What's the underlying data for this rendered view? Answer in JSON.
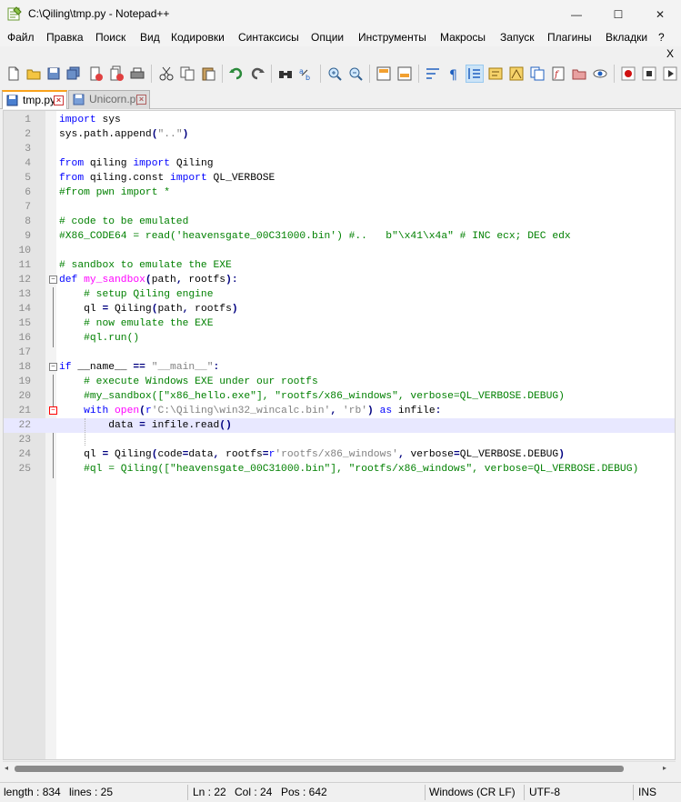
{
  "window": {
    "title": "C:\\Qiling\\tmp.py - Notepad++",
    "minimize_glyph": "—",
    "maximize_glyph": "☐",
    "close_glyph": "✕"
  },
  "menu": {
    "items": [
      "Файл",
      "Правка",
      "Поиск",
      "Вид",
      "Кодировки",
      "Синтаксисы",
      "Опции",
      "Инструменты",
      "Макросы",
      "Запуск",
      "Плагины",
      "Вкладки",
      "?"
    ],
    "close_x": "X"
  },
  "toolbar": {
    "icons": [
      "new-file-icon",
      "open-file-icon",
      "save-icon",
      "save-all-icon",
      "close-icon",
      "close-all-icon",
      "print-icon",
      "cut-icon",
      "copy-icon",
      "paste-icon",
      "undo-icon",
      "redo-icon",
      "find-icon",
      "replace-icon",
      "zoom-in-icon",
      "zoom-out-icon",
      "sync-vertical-icon",
      "sync-horizontal-icon",
      "word-wrap-icon",
      "all-chars-icon",
      "indent-guide-icon",
      "udl-icon",
      "doc-map-icon",
      "doc-list-icon",
      "function-list-icon",
      "folder-workspace-icon",
      "monitoring-icon",
      "record-macro-icon",
      "stop-macro-icon"
    ]
  },
  "tabs": [
    {
      "label": "tmp.py",
      "active": true
    },
    {
      "label": "Unicorn.py",
      "active": false
    }
  ],
  "code_lines": [
    {
      "n": "1",
      "text": "import sys"
    },
    {
      "n": "2",
      "text": "sys.path.append(\"..\")"
    },
    {
      "n": "3",
      "text": ""
    },
    {
      "n": "4",
      "text": "from qiling import Qiling"
    },
    {
      "n": "5",
      "text": "from qiling.const import QL_VERBOSE"
    },
    {
      "n": "6",
      "text": "#from pwn import *"
    },
    {
      "n": "7",
      "text": ""
    },
    {
      "n": "8",
      "text": "# code to be emulated"
    },
    {
      "n": "9",
      "text": "#X86_CODE64 = read('heavensgate_00C31000.bin') #..   b\"\\x41\\x4a\" # INC ecx; DEC edx"
    },
    {
      "n": "10",
      "text": ""
    },
    {
      "n": "11",
      "text": "# sandbox to emulate the EXE"
    },
    {
      "n": "12",
      "text": "def my_sandbox(path, rootfs):"
    },
    {
      "n": "13",
      "text": "    # setup Qiling engine"
    },
    {
      "n": "14",
      "text": "    ql = Qiling(path, rootfs)"
    },
    {
      "n": "15",
      "text": "    # now emulate the EXE"
    },
    {
      "n": "16",
      "text": "    #ql.run()"
    },
    {
      "n": "17",
      "text": ""
    },
    {
      "n": "18",
      "text": "if __name__ == \"__main__\":"
    },
    {
      "n": "19",
      "text": "    # execute Windows EXE under our rootfs"
    },
    {
      "n": "20",
      "text": "    #my_sandbox([\"x86_hello.exe\"], \"rootfs/x86_windows\", verbose=QL_VERBOSE.DEBUG)"
    },
    {
      "n": "21",
      "text": "    with open(r'C:\\Qiling\\win32_wincalc.bin', 'rb') as infile:"
    },
    {
      "n": "22",
      "text": "        data = infile.read()"
    },
    {
      "n": "23",
      "text": ""
    },
    {
      "n": "24",
      "text": "    ql = Qiling(code=data, rootfs=r'rootfs/x86_windows', verbose=QL_VERBOSE.DEBUG)"
    },
    {
      "n": "25",
      "text": "    #ql = Qiling([\"heavensgate_00C31000.bin\"], \"rootfs/x86_windows\", verbose=QL_VERBOSE.DEBUG)"
    }
  ],
  "current_line": 22,
  "status": {
    "length": "length : 834",
    "lines": "lines : 25",
    "ln": "Ln : 22",
    "col": "Col : 24",
    "pos": "Pos : 642",
    "eol": "Windows (CR LF)",
    "encoding": "UTF-8",
    "mode": "INS"
  },
  "colors": {
    "keyword": "#0000ff",
    "function": "#ff00ff",
    "string": "#808080",
    "comment": "#008000",
    "current_line_bg": "#e8e8ff",
    "active_tab_accent": "#f9a21b"
  }
}
